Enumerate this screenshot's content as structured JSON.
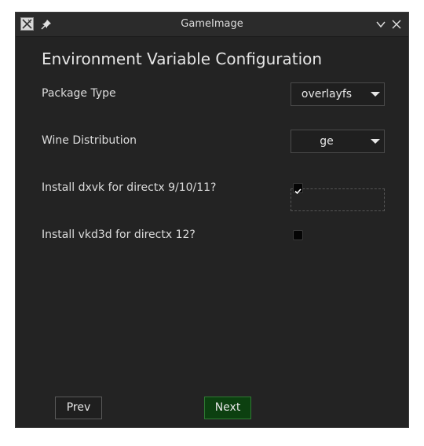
{
  "window": {
    "title": "GameImage"
  },
  "page": {
    "heading": "Environment Variable Configuration"
  },
  "fields": {
    "package_type": {
      "label": "Package Type",
      "value": "overlayfs"
    },
    "wine_distribution": {
      "label": "Wine Distribution",
      "value": "ge"
    },
    "dxvk": {
      "label": "Install dxvk for directx 9/10/11?",
      "checked": true
    },
    "vkd3d": {
      "label": "Install vkd3d for directx 12?",
      "checked": false
    }
  },
  "buttons": {
    "prev": "Prev",
    "next": "Next"
  },
  "icons": {
    "app": "app-icon",
    "pin": "pin-icon",
    "minimize": "chevron-down-icon",
    "close": "close-icon",
    "dropdown": "dropdown-arrow-icon",
    "check": "check-icon"
  },
  "colors": {
    "background": "#232323",
    "next_button": "#0c4010",
    "checkmark": "#ffffff"
  }
}
